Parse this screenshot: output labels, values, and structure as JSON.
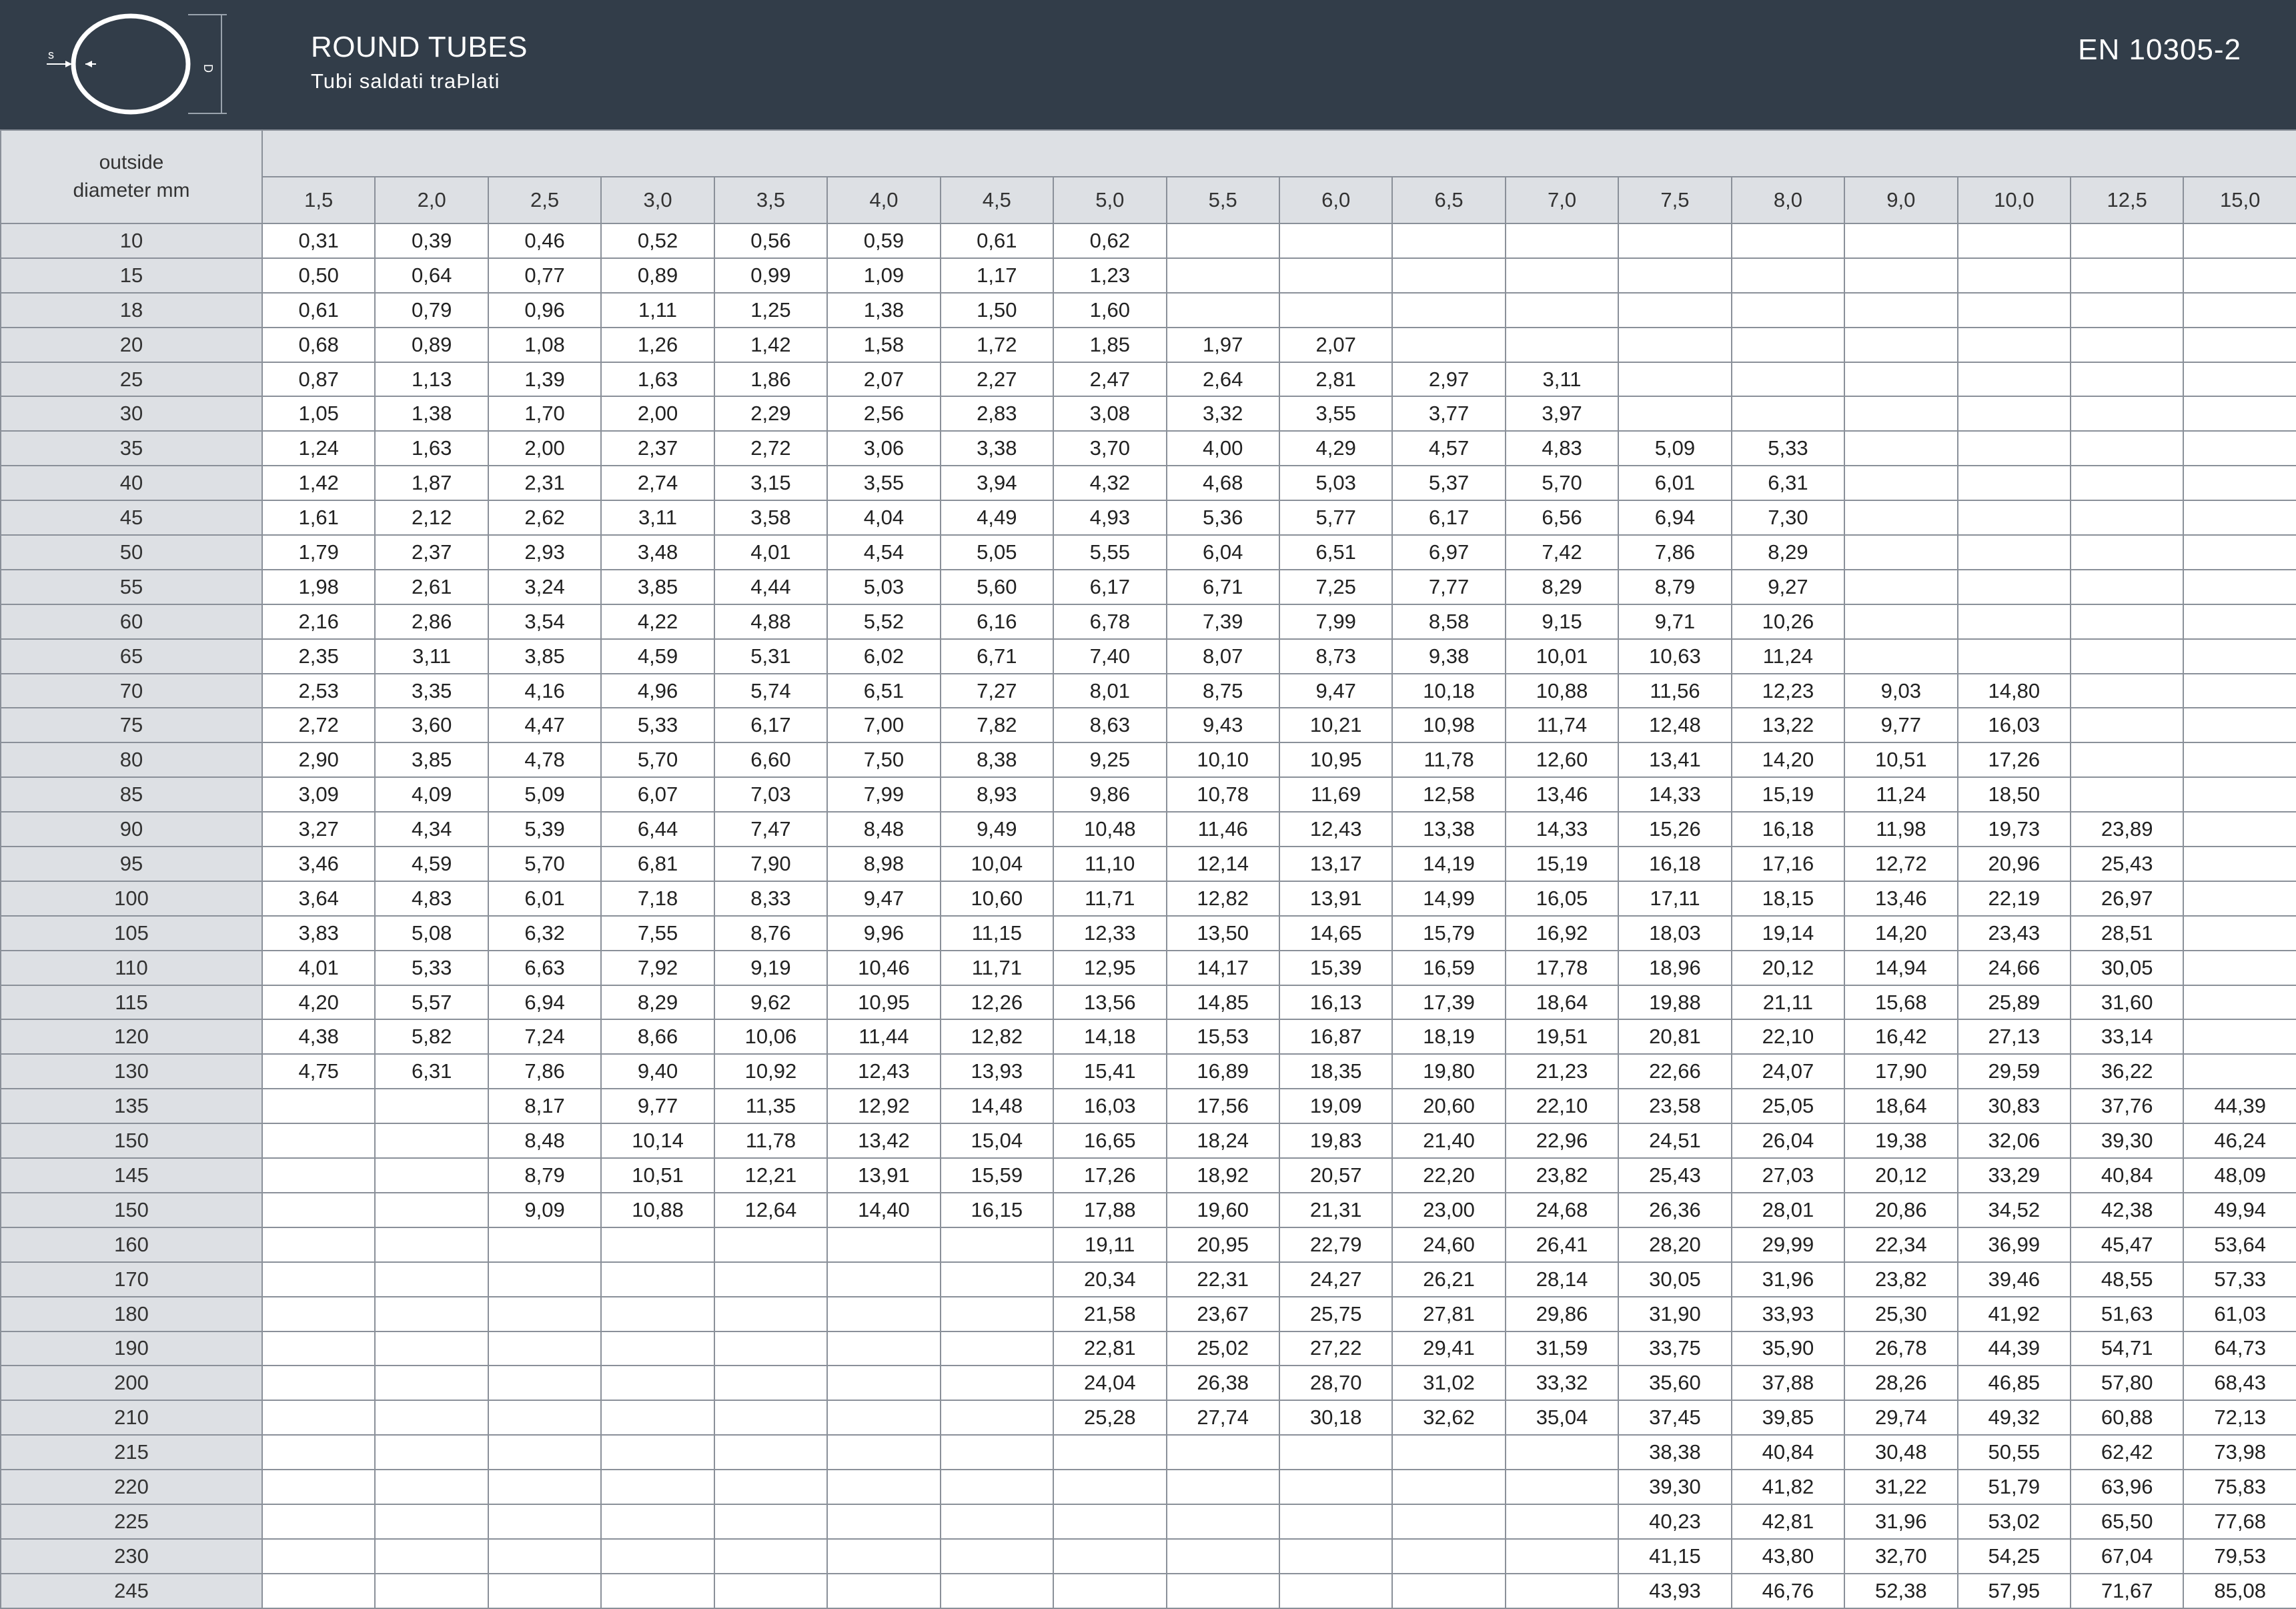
{
  "header": {
    "title": "ROUND TUBES",
    "subtitle": "Tubi saldati traÞlati",
    "standard": "EN 10305-2",
    "icon": {
      "name": "round-tube-section-icon",
      "label_s": "s",
      "label_d": "D"
    }
  },
  "table": {
    "row_header_line1": "outside",
    "row_header_line2": "diameter mm",
    "columns": [
      "1,5",
      "2,0",
      "2,5",
      "3,0",
      "3,5",
      "4,0",
      "4,5",
      "5,0",
      "5,5",
      "6,0",
      "6,5",
      "7,0",
      "7,5",
      "8,0",
      "9,0",
      "10,0",
      "12,5",
      "15,0"
    ],
    "rows": [
      {
        "od": "10",
        "v": [
          "0,31",
          "0,39",
          "0,46",
          "0,52",
          "0,56",
          "0,59",
          "0,61",
          "0,62",
          "",
          "",
          "",
          "",
          "",
          "",
          "",
          "",
          "",
          ""
        ]
      },
      {
        "od": "15",
        "v": [
          "0,50",
          "0,64",
          "0,77",
          "0,89",
          "0,99",
          "1,09",
          "1,17",
          "1,23",
          "",
          "",
          "",
          "",
          "",
          "",
          "",
          "",
          "",
          ""
        ]
      },
      {
        "od": "18",
        "v": [
          "0,61",
          "0,79",
          "0,96",
          "1,11",
          "1,25",
          "1,38",
          "1,50",
          "1,60",
          "",
          "",
          "",
          "",
          "",
          "",
          "",
          "",
          "",
          ""
        ]
      },
      {
        "od": "20",
        "v": [
          "0,68",
          "0,89",
          "1,08",
          "1,26",
          "1,42",
          "1,58",
          "1,72",
          "1,85",
          "1,97",
          "2,07",
          "",
          "",
          "",
          "",
          "",
          "",
          "",
          ""
        ]
      },
      {
        "od": "25",
        "v": [
          "0,87",
          "1,13",
          "1,39",
          "1,63",
          "1,86",
          "2,07",
          "2,27",
          "2,47",
          "2,64",
          "2,81",
          "2,97",
          "3,11",
          "",
          "",
          "",
          "",
          "",
          ""
        ]
      },
      {
        "od": "30",
        "v": [
          "1,05",
          "1,38",
          "1,70",
          "2,00",
          "2,29",
          "2,56",
          "2,83",
          "3,08",
          "3,32",
          "3,55",
          "3,77",
          "3,97",
          "",
          "",
          "",
          "",
          "",
          ""
        ]
      },
      {
        "od": "35",
        "v": [
          "1,24",
          "1,63",
          "2,00",
          "2,37",
          "2,72",
          "3,06",
          "3,38",
          "3,70",
          "4,00",
          "4,29",
          "4,57",
          "4,83",
          "5,09",
          "5,33",
          "",
          "",
          "",
          ""
        ]
      },
      {
        "od": "40",
        "v": [
          "1,42",
          "1,87",
          "2,31",
          "2,74",
          "3,15",
          "3,55",
          "3,94",
          "4,32",
          "4,68",
          "5,03",
          "5,37",
          "5,70",
          "6,01",
          "6,31",
          "",
          "",
          "",
          ""
        ]
      },
      {
        "od": "45",
        "v": [
          "1,61",
          "2,12",
          "2,62",
          "3,11",
          "3,58",
          "4,04",
          "4,49",
          "4,93",
          "5,36",
          "5,77",
          "6,17",
          "6,56",
          "6,94",
          "7,30",
          "",
          "",
          "",
          ""
        ]
      },
      {
        "od": "50",
        "v": [
          "1,79",
          "2,37",
          "2,93",
          "3,48",
          "4,01",
          "4,54",
          "5,05",
          "5,55",
          "6,04",
          "6,51",
          "6,97",
          "7,42",
          "7,86",
          "8,29",
          "",
          "",
          "",
          ""
        ]
      },
      {
        "od": "55",
        "v": [
          "1,98",
          "2,61",
          "3,24",
          "3,85",
          "4,44",
          "5,03",
          "5,60",
          "6,17",
          "6,71",
          "7,25",
          "7,77",
          "8,29",
          "8,79",
          "9,27",
          "",
          "",
          "",
          ""
        ]
      },
      {
        "od": "60",
        "v": [
          "2,16",
          "2,86",
          "3,54",
          "4,22",
          "4,88",
          "5,52",
          "6,16",
          "6,78",
          "7,39",
          "7,99",
          "8,58",
          "9,15",
          "9,71",
          "10,26",
          "",
          "",
          "",
          ""
        ]
      },
      {
        "od": "65",
        "v": [
          "2,35",
          "3,11",
          "3,85",
          "4,59",
          "5,31",
          "6,02",
          "6,71",
          "7,40",
          "8,07",
          "8,73",
          "9,38",
          "10,01",
          "10,63",
          "11,24",
          "",
          "",
          "",
          ""
        ]
      },
      {
        "od": "70",
        "v": [
          "2,53",
          "3,35",
          "4,16",
          "4,96",
          "5,74",
          "6,51",
          "7,27",
          "8,01",
          "8,75",
          "9,47",
          "10,18",
          "10,88",
          "11,56",
          "12,23",
          "9,03",
          "14,80",
          "",
          ""
        ]
      },
      {
        "od": "75",
        "v": [
          "2,72",
          "3,60",
          "4,47",
          "5,33",
          "6,17",
          "7,00",
          "7,82",
          "8,63",
          "9,43",
          "10,21",
          "10,98",
          "11,74",
          "12,48",
          "13,22",
          "9,77",
          "16,03",
          "",
          ""
        ]
      },
      {
        "od": "80",
        "v": [
          "2,90",
          "3,85",
          "4,78",
          "5,70",
          "6,60",
          "7,50",
          "8,38",
          "9,25",
          "10,10",
          "10,95",
          "11,78",
          "12,60",
          "13,41",
          "14,20",
          "10,51",
          "17,26",
          "",
          ""
        ]
      },
      {
        "od": "85",
        "v": [
          "3,09",
          "4,09",
          "5,09",
          "6,07",
          "7,03",
          "7,99",
          "8,93",
          "9,86",
          "10,78",
          "11,69",
          "12,58",
          "13,46",
          "14,33",
          "15,19",
          "11,24",
          "18,50",
          "",
          ""
        ]
      },
      {
        "od": "90",
        "v": [
          "3,27",
          "4,34",
          "5,39",
          "6,44",
          "7,47",
          "8,48",
          "9,49",
          "10,48",
          "11,46",
          "12,43",
          "13,38",
          "14,33",
          "15,26",
          "16,18",
          "11,98",
          "19,73",
          "23,89",
          ""
        ]
      },
      {
        "od": "95",
        "v": [
          "3,46",
          "4,59",
          "5,70",
          "6,81",
          "7,90",
          "8,98",
          "10,04",
          "11,10",
          "12,14",
          "13,17",
          "14,19",
          "15,19",
          "16,18",
          "17,16",
          "12,72",
          "20,96",
          "25,43",
          ""
        ]
      },
      {
        "od": "100",
        "v": [
          "3,64",
          "4,83",
          "6,01",
          "7,18",
          "8,33",
          "9,47",
          "10,60",
          "11,71",
          "12,82",
          "13,91",
          "14,99",
          "16,05",
          "17,11",
          "18,15",
          "13,46",
          "22,19",
          "26,97",
          ""
        ]
      },
      {
        "od": "105",
        "v": [
          "3,83",
          "5,08",
          "6,32",
          "7,55",
          "8,76",
          "9,96",
          "11,15",
          "12,33",
          "13,50",
          "14,65",
          "15,79",
          "16,92",
          "18,03",
          "19,14",
          "14,20",
          "23,43",
          "28,51",
          ""
        ]
      },
      {
        "od": "110",
        "v": [
          "4,01",
          "5,33",
          "6,63",
          "7,92",
          "9,19",
          "10,46",
          "11,71",
          "12,95",
          "14,17",
          "15,39",
          "16,59",
          "17,78",
          "18,96",
          "20,12",
          "14,94",
          "24,66",
          "30,05",
          ""
        ]
      },
      {
        "od": "115",
        "v": [
          "4,20",
          "5,57",
          "6,94",
          "8,29",
          "9,62",
          "10,95",
          "12,26",
          "13,56",
          "14,85",
          "16,13",
          "17,39",
          "18,64",
          "19,88",
          "21,11",
          "15,68",
          "25,89",
          "31,60",
          ""
        ]
      },
      {
        "od": "120",
        "v": [
          "4,38",
          "5,82",
          "7,24",
          "8,66",
          "10,06",
          "11,44",
          "12,82",
          "14,18",
          "15,53",
          "16,87",
          "18,19",
          "19,51",
          "20,81",
          "22,10",
          "16,42",
          "27,13",
          "33,14",
          ""
        ]
      },
      {
        "od": "130",
        "v": [
          "4,75",
          "6,31",
          "7,86",
          "9,40",
          "10,92",
          "12,43",
          "13,93",
          "15,41",
          "16,89",
          "18,35",
          "19,80",
          "21,23",
          "22,66",
          "24,07",
          "17,90",
          "29,59",
          "36,22",
          ""
        ]
      },
      {
        "od": "135",
        "v": [
          "",
          "",
          "8,17",
          "9,77",
          "11,35",
          "12,92",
          "14,48",
          "16,03",
          "17,56",
          "19,09",
          "20,60",
          "22,10",
          "23,58",
          "25,05",
          "18,64",
          "30,83",
          "37,76",
          "44,39"
        ]
      },
      {
        "od": "150",
        "v": [
          "",
          "",
          "8,48",
          "10,14",
          "11,78",
          "13,42",
          "15,04",
          "16,65",
          "18,24",
          "19,83",
          "21,40",
          "22,96",
          "24,51",
          "26,04",
          "19,38",
          "32,06",
          "39,30",
          "46,24"
        ]
      },
      {
        "od": "145",
        "v": [
          "",
          "",
          "8,79",
          "10,51",
          "12,21",
          "13,91",
          "15,59",
          "17,26",
          "18,92",
          "20,57",
          "22,20",
          "23,82",
          "25,43",
          "27,03",
          "20,12",
          "33,29",
          "40,84",
          "48,09"
        ]
      },
      {
        "od": "150",
        "v": [
          "",
          "",
          "9,09",
          "10,88",
          "12,64",
          "14,40",
          "16,15",
          "17,88",
          "19,60",
          "21,31",
          "23,00",
          "24,68",
          "26,36",
          "28,01",
          "20,86",
          "34,52",
          "42,38",
          "49,94"
        ]
      },
      {
        "od": "160",
        "v": [
          "",
          "",
          "",
          "",
          "",
          "",
          "",
          "19,11",
          "20,95",
          "22,79",
          "24,60",
          "26,41",
          "28,20",
          "29,99",
          "22,34",
          "36,99",
          "45,47",
          "53,64"
        ]
      },
      {
        "od": "170",
        "v": [
          "",
          "",
          "",
          "",
          "",
          "",
          "",
          "20,34",
          "22,31",
          "24,27",
          "26,21",
          "28,14",
          "30,05",
          "31,96",
          "23,82",
          "39,46",
          "48,55",
          "57,33"
        ]
      },
      {
        "od": "180",
        "v": [
          "",
          "",
          "",
          "",
          "",
          "",
          "",
          "21,58",
          "23,67",
          "25,75",
          "27,81",
          "29,86",
          "31,90",
          "33,93",
          "25,30",
          "41,92",
          "51,63",
          "61,03"
        ]
      },
      {
        "od": "190",
        "v": [
          "",
          "",
          "",
          "",
          "",
          "",
          "",
          "22,81",
          "25,02",
          "27,22",
          "29,41",
          "31,59",
          "33,75",
          "35,90",
          "26,78",
          "44,39",
          "54,71",
          "64,73"
        ]
      },
      {
        "od": "200",
        "v": [
          "",
          "",
          "",
          "",
          "",
          "",
          "",
          "24,04",
          "26,38",
          "28,70",
          "31,02",
          "33,32",
          "35,60",
          "37,88",
          "28,26",
          "46,85",
          "57,80",
          "68,43"
        ]
      },
      {
        "od": "210",
        "v": [
          "",
          "",
          "",
          "",
          "",
          "",
          "",
          "25,28",
          "27,74",
          "30,18",
          "32,62",
          "35,04",
          "37,45",
          "39,85",
          "29,74",
          "49,32",
          "60,88",
          "72,13"
        ]
      },
      {
        "od": "215",
        "v": [
          "",
          "",
          "",
          "",
          "",
          "",
          "",
          "",
          "",
          "",
          "",
          "",
          "38,38",
          "40,84",
          "30,48",
          "50,55",
          "62,42",
          "73,98"
        ]
      },
      {
        "od": "220",
        "v": [
          "",
          "",
          "",
          "",
          "",
          "",
          "",
          "",
          "",
          "",
          "",
          "",
          "39,30",
          "41,82",
          "31,22",
          "51,79",
          "63,96",
          "75,83"
        ]
      },
      {
        "od": "225",
        "v": [
          "",
          "",
          "",
          "",
          "",
          "",
          "",
          "",
          "",
          "",
          "",
          "",
          "40,23",
          "42,81",
          "31,96",
          "53,02",
          "65,50",
          "77,68"
        ]
      },
      {
        "od": "230",
        "v": [
          "",
          "",
          "",
          "",
          "",
          "",
          "",
          "",
          "",
          "",
          "",
          "",
          "41,15",
          "43,80",
          "32,70",
          "54,25",
          "67,04",
          "79,53"
        ]
      },
      {
        "od": "245",
        "v": [
          "",
          "",
          "",
          "",
          "",
          "",
          "",
          "",
          "",
          "",
          "",
          "",
          "43,93",
          "46,76",
          "52,38",
          "57,95",
          "71,67",
          "85,08"
        ]
      }
    ]
  }
}
